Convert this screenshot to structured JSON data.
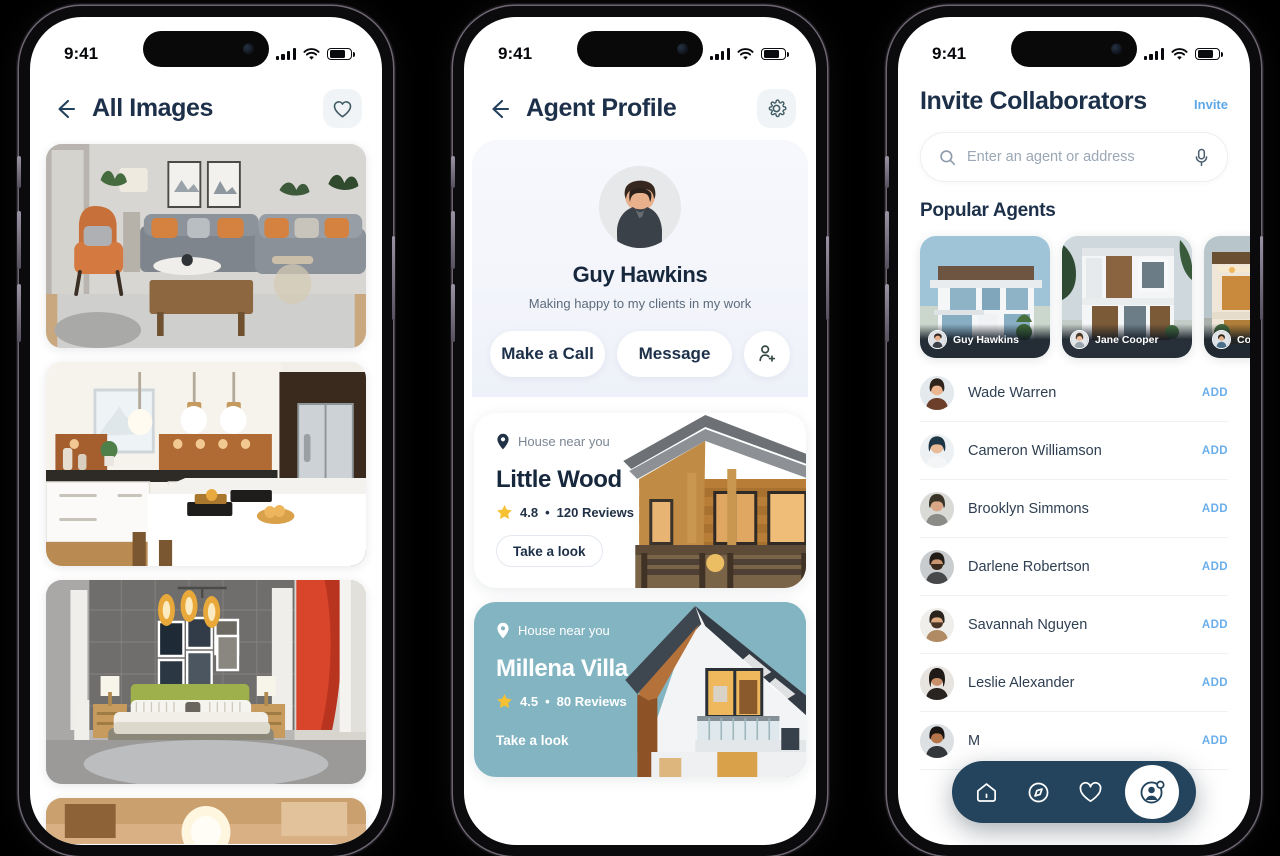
{
  "status_bar": {
    "time": "9:41",
    "signal_icon": "cellular-bars-icon",
    "wifi_icon": "wifi-icon",
    "battery_icon": "battery-icon"
  },
  "phone1": {
    "header": {
      "back_icon": "back-arrow-icon",
      "title": "All Images",
      "action_icon": "heart-icon"
    },
    "gallery": [
      {
        "name": "living-room-photo",
        "alt": "Modern living room with grey sofa and orange armchair"
      },
      {
        "name": "kitchen-photo",
        "alt": "White kitchen with island and pendant lights"
      },
      {
        "name": "bedroom-photo",
        "alt": "Bedroom with green headboard and red curtains"
      },
      {
        "name": "interior-photo-partial",
        "alt": "Interior photo partially visible"
      }
    ]
  },
  "phone2": {
    "header": {
      "back_icon": "back-arrow-icon",
      "title": "Agent Profile",
      "action_icon": "gear-icon"
    },
    "profile": {
      "avatar": "agent-avatar",
      "name": "Guy Hawkins",
      "tagline": "Making happy to my clients in my work",
      "call_label": "Make a Call",
      "message_label": "Message",
      "add_person_icon": "add-person-icon"
    },
    "property_cards": [
      {
        "near_label": "House near you",
        "title": "Little Wood",
        "rating": "4.8",
        "reviews": "120 Reviews",
        "separator": "•",
        "cta": "Take a look",
        "theme": "white",
        "accent": "#ffffff",
        "art": "wood-cabin-illustration"
      },
      {
        "near_label": "House near you",
        "title": "Millena Villa",
        "rating": "4.5",
        "reviews": "80 Reviews",
        "separator": "•",
        "cta": "Take a look",
        "theme": "teal",
        "accent": "#82b4c2",
        "art": "modern-villa-illustration"
      }
    ]
  },
  "phone3": {
    "title": "Invite Collaborators",
    "invite_link": "Invite",
    "search": {
      "placeholder": "Enter an agent or address",
      "value": "",
      "search_icon": "search-icon",
      "mic_icon": "microphone-icon"
    },
    "section_title": "Popular Agents",
    "popular_agents": [
      {
        "name": "Guy Hawkins",
        "house": "white-modern-house"
      },
      {
        "name": "Jane Cooper",
        "house": "two-storey-villa"
      },
      {
        "name": "Cody Fis",
        "house": "warm-lit-villa"
      }
    ],
    "agent_list": [
      {
        "name": "Wade Warren",
        "action": "ADD"
      },
      {
        "name": "Cameron Williamson",
        "action": "ADD"
      },
      {
        "name": "Brooklyn Simmons",
        "action": "ADD"
      },
      {
        "name": "Darlene Robertson",
        "action": "ADD"
      },
      {
        "name": "Savannah Nguyen",
        "action": "ADD"
      },
      {
        "name": "Leslie Alexander",
        "action": "ADD"
      },
      {
        "name": "M",
        "action": "ADD"
      }
    ],
    "bottom_nav": [
      {
        "icon": "home-icon",
        "active": false
      },
      {
        "icon": "compass-icon",
        "active": false
      },
      {
        "icon": "heart-icon",
        "active": false
      },
      {
        "icon": "profile-add-icon",
        "active": true
      }
    ],
    "colors": {
      "nav_background": "#23445c",
      "link": "#6aaeea",
      "title": "#1d3049"
    }
  }
}
